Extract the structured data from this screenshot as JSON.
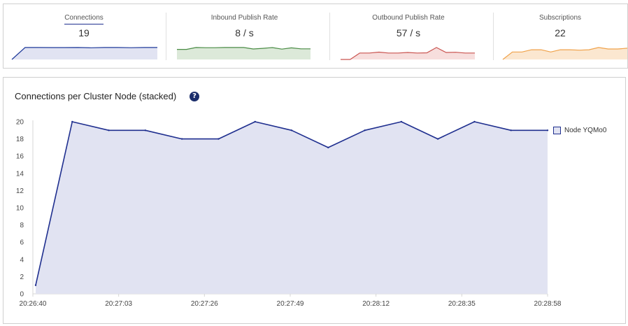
{
  "stats": [
    {
      "label": "Connections",
      "value": "19",
      "color": "#1f3a9a",
      "fill": "#e1e3f2",
      "active": true,
      "spark": [
        0,
        19,
        19,
        18.8,
        18.8,
        19,
        18.5,
        19,
        19,
        18.6,
        19,
        19
      ]
    },
    {
      "label": "Inbound Publish Rate",
      "value": "8 / s",
      "color": "#4a8c45",
      "fill": "#dce9d9",
      "active": false,
      "spark": [
        8,
        8,
        9.5,
        9.3,
        9.3,
        9.5,
        9.5,
        9.5,
        8.3,
        8.8,
        9.4,
        8.2,
        9.2,
        8.4,
        8.4
      ]
    },
    {
      "label": "Outbound Publish Rate",
      "value": "57 / s",
      "color": "#c9534f",
      "fill": "#f7dedd",
      "active": false,
      "spark": [
        0,
        0,
        3.5,
        3.5,
        4,
        3.5,
        3.5,
        3.8,
        3.5,
        3.6,
        6.5,
        3.8,
        3.9,
        3.5,
        3.5
      ]
    },
    {
      "label": "Subscriptions",
      "value": "22",
      "color": "#f0a24a",
      "fill": "#fbe7d0",
      "active": false,
      "spark": [
        0,
        5,
        5,
        6.5,
        6.5,
        5,
        6.5,
        6.5,
        6.2,
        6.5,
        8,
        7,
        7,
        7.5
      ]
    }
  ],
  "chart_panel": {
    "title": "Connections per Cluster Node (stacked)",
    "help": "?"
  },
  "chart_data": {
    "type": "area",
    "title": "Connections per Cluster Node (stacked)",
    "xlabel": "",
    "ylabel": "",
    "ylim": [
      0,
      20
    ],
    "yticks": [
      0,
      2,
      4,
      6,
      8,
      10,
      12,
      14,
      16,
      18,
      20
    ],
    "xtick_labels": [
      "20:26:40",
      "20:27:03",
      "20:27:26",
      "20:27:49",
      "20:28:12",
      "20:28:35",
      "20:28:58"
    ],
    "legend_position": "right",
    "grid": false,
    "series": [
      {
        "name": "Node YQMo0",
        "color": "#1f2f8f",
        "fill": "#e1e3f2",
        "x": [
          "20:26:40",
          "20:26:50",
          "20:27:00",
          "20:27:10",
          "20:27:20",
          "20:27:30",
          "20:27:40",
          "20:27:50",
          "20:28:00",
          "20:28:10",
          "20:28:20",
          "20:28:30",
          "20:28:40",
          "20:28:50",
          "20:29:00"
        ],
        "values": [
          1,
          20,
          19,
          19,
          18,
          18,
          20,
          19,
          17,
          19,
          20,
          18,
          20,
          19,
          19
        ]
      }
    ]
  }
}
